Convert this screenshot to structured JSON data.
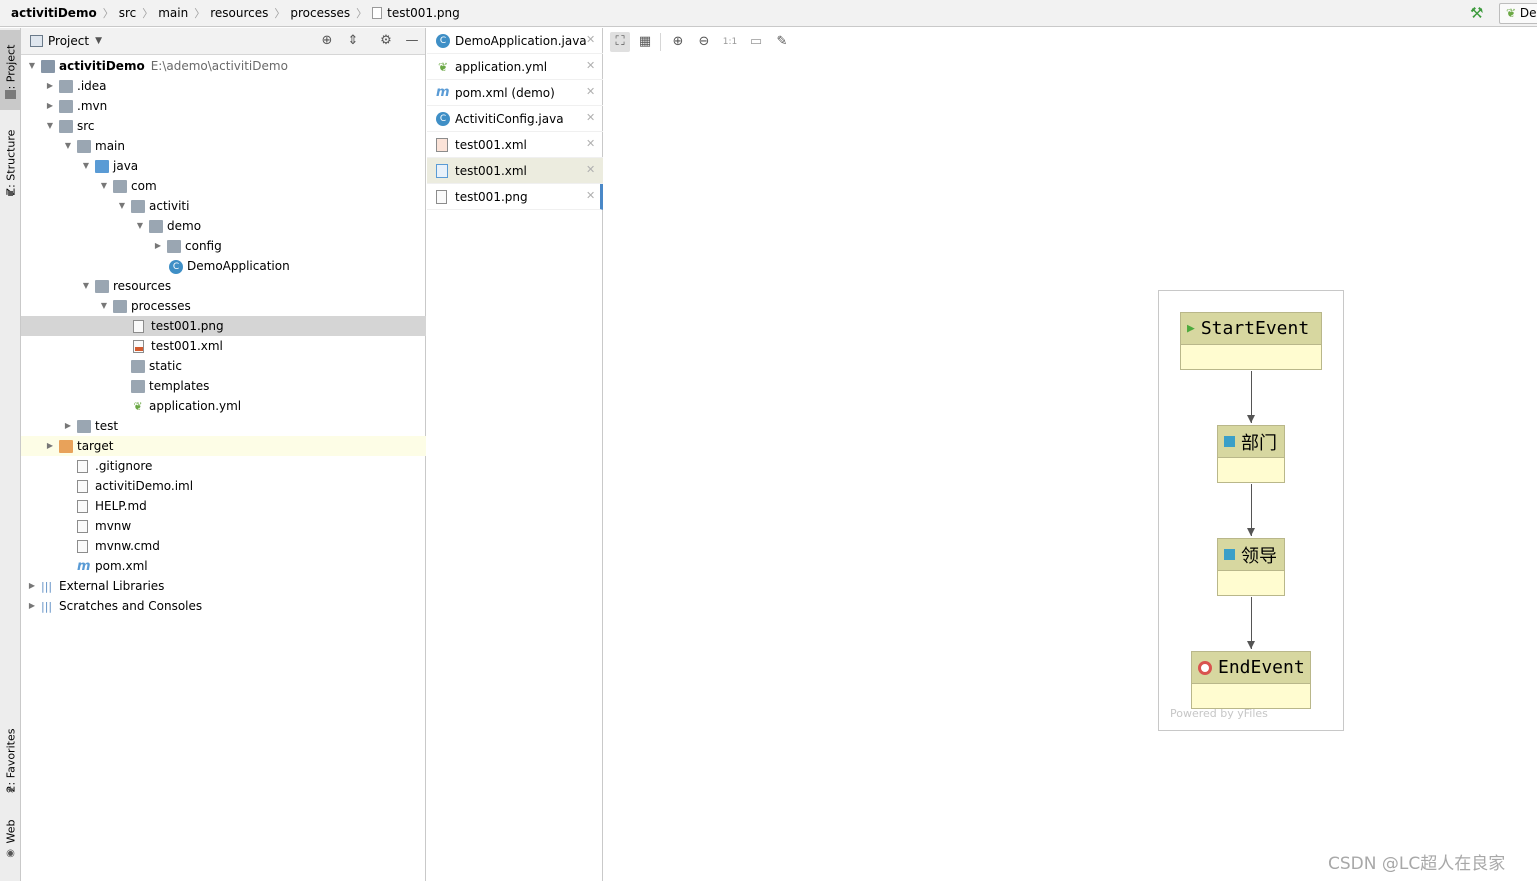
{
  "breadcrumb": {
    "items": [
      "activitiDemo",
      "src",
      "main",
      "resources",
      "processes",
      "test001.png"
    ]
  },
  "run_config": {
    "label": "De"
  },
  "side_tabs": {
    "project": "1: Project",
    "structure": "Z: Structure",
    "favorites": "2: Favorites",
    "web": "Web"
  },
  "project_panel": {
    "title": "Project",
    "root_path": "E:\\ademo\\activitiDemo",
    "tree": [
      {
        "label": "activitiDemo",
        "bold": true
      },
      {
        "label": ".idea"
      },
      {
        "label": ".mvn"
      },
      {
        "label": "src"
      },
      {
        "label": "main"
      },
      {
        "label": "java"
      },
      {
        "label": "com"
      },
      {
        "label": "activiti"
      },
      {
        "label": "demo"
      },
      {
        "label": "config"
      },
      {
        "label": "DemoApplication"
      },
      {
        "label": "resources"
      },
      {
        "label": "processes"
      },
      {
        "label": "test001.png"
      },
      {
        "label": "test001.xml"
      },
      {
        "label": "static"
      },
      {
        "label": "templates"
      },
      {
        "label": "application.yml"
      },
      {
        "label": "test"
      },
      {
        "label": "target"
      },
      {
        "label": ".gitignore"
      },
      {
        "label": "activitiDemo.iml"
      },
      {
        "label": "HELP.md"
      },
      {
        "label": "mvnw"
      },
      {
        "label": "mvnw.cmd"
      },
      {
        "label": "pom.xml"
      },
      {
        "label": "External Libraries"
      },
      {
        "label": "Scratches and Consoles"
      }
    ]
  },
  "editor_tabs": [
    {
      "label": "DemoApplication.java",
      "icon": "java-class-icon"
    },
    {
      "label": "application.yml",
      "icon": "yaml-icon"
    },
    {
      "label": "pom.xml (demo)",
      "icon": "maven-icon"
    },
    {
      "label": "ActivitiConfig.java",
      "icon": "java-class-icon"
    },
    {
      "label": "test001.xml",
      "icon": "xml-icon"
    },
    {
      "label": "test001.xml",
      "icon": "bpmn-icon"
    },
    {
      "label": "test001.png",
      "icon": "image-icon"
    }
  ],
  "image_toolbar": {
    "zoom_actual_label": "1:1"
  },
  "diagram": {
    "nodes": [
      {
        "label": "StartEvent",
        "icon": "start-triangle-icon"
      },
      {
        "label": "部门",
        "icon": "task-square-icon"
      },
      {
        "label": "领导",
        "icon": "task-square-icon"
      },
      {
        "label": "EndEvent",
        "icon": "end-circle-icon"
      }
    ],
    "powered_by": "Powered by yFiles"
  },
  "watermark": "CSDN @LC超人在良家",
  "colors": {
    "node_header": "#d7d7a0",
    "node_body": "#fffcd0",
    "selection": "#d5d5d5",
    "accent_blue": "#4a88c7"
  }
}
